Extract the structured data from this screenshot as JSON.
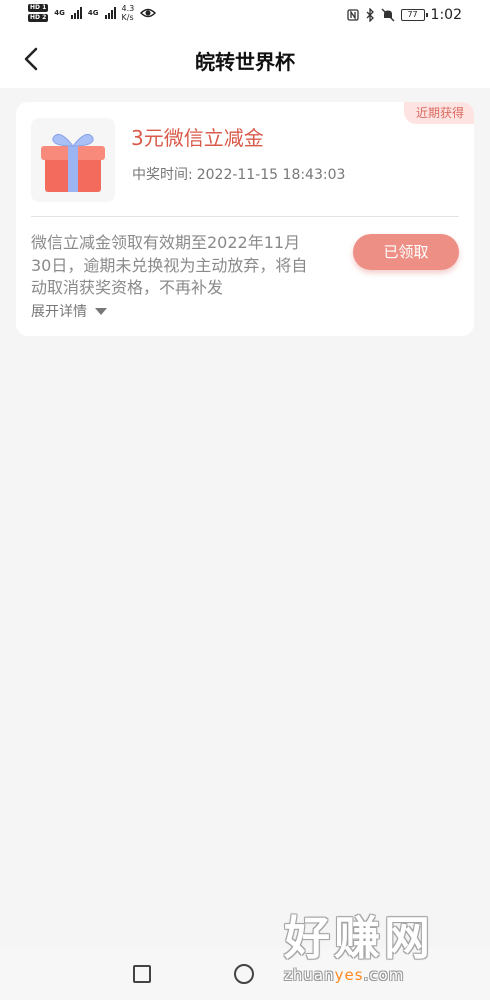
{
  "status_bar": {
    "hd1": "HD 1",
    "hd2": "HD 2",
    "net1": "4G",
    "net2": "4G",
    "speed_value": "4.3",
    "speed_unit": "K/s",
    "battery": "77",
    "time": "1:02"
  },
  "header": {
    "title": "皖转世界杯"
  },
  "prize_card": {
    "tag": "近期获得",
    "name": "3元微信立减金",
    "time_label": "中奖时间:",
    "time_value": "2022-11-15 18:43:03",
    "description": "微信立减金领取有效期至2022年11月30日，逾期未兑换视为主动放弃，将自动取消获奖资格，不再补发",
    "button_label": "已领取",
    "expand_label": "展开详情"
  },
  "watermark": {
    "big": "好赚网",
    "small_a": "zhuan",
    "small_b": "yes",
    "small_c": ".com"
  },
  "colors": {
    "accent": "#d95a4a",
    "button": "#ee8f85",
    "tag_bg": "#fde4e2"
  }
}
